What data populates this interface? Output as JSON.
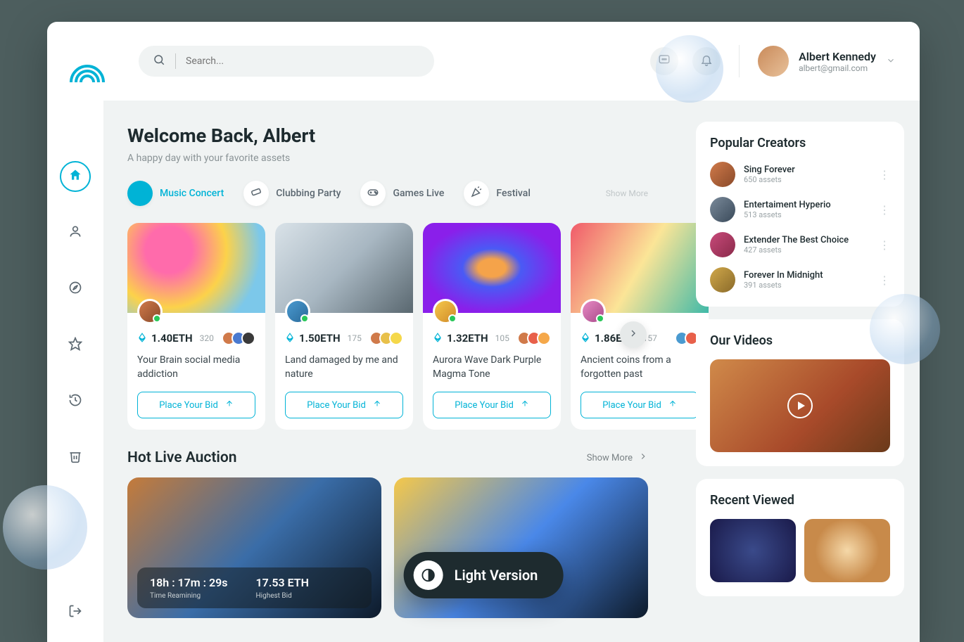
{
  "header": {
    "search_placeholder": "Search...",
    "user_name": "Albert Kennedy",
    "user_email": "albert@gmail.com"
  },
  "welcome": {
    "title": "Welcome Back, Albert",
    "subtitle": "A happy day with your favorite assets"
  },
  "categories": {
    "items": [
      {
        "label": "Music Concert"
      },
      {
        "label": "Clubbing Party"
      },
      {
        "label": "Games Live"
      },
      {
        "label": "Festival"
      }
    ],
    "show_more": "Show More"
  },
  "cards": [
    {
      "price": "1.40ETH",
      "count": "320",
      "title": "Your Brain social media addiction",
      "bid": "Place Your Bid"
    },
    {
      "price": "1.50ETH",
      "count": "175",
      "title": "Land damaged by me and nature",
      "bid": "Place Your Bid"
    },
    {
      "price": "1.32ETH",
      "count": "105",
      "title": "Aurora Wave Dark Purple Magma Tone",
      "bid": "Place Your Bid"
    },
    {
      "price": "1.86ETH",
      "count": "157",
      "title": "Ancient coins from a forgotten past",
      "bid": "Place Your Bid"
    }
  ],
  "auction": {
    "heading": "Hot Live Auction",
    "show_more": "Show More",
    "items": [
      {
        "time": "18h : 17m : 29s",
        "time_label": "Time Reamining",
        "bid": "17.53 ETH",
        "bid_label": "Highest Bid"
      },
      {
        "time": "",
        "time_label": "",
        "bid": "",
        "bid_label": ""
      }
    ]
  },
  "creators": {
    "heading": "Popular Creators",
    "items": [
      {
        "name": "Sing Forever",
        "assets": "650 assets"
      },
      {
        "name": "Entertaiment Hyperio",
        "assets": "513 assets"
      },
      {
        "name": "Extender The Best Choice",
        "assets": "427 assets"
      },
      {
        "name": "Forever In Midnight",
        "assets": "391 assets"
      }
    ]
  },
  "videos": {
    "heading": "Our Videos"
  },
  "recent": {
    "heading": "Recent Viewed"
  },
  "fab": {
    "label": "Light Version"
  },
  "colors": {
    "accent": "#00b3d6",
    "bg": "#f0f3f3",
    "text": "#1e2b2f"
  }
}
